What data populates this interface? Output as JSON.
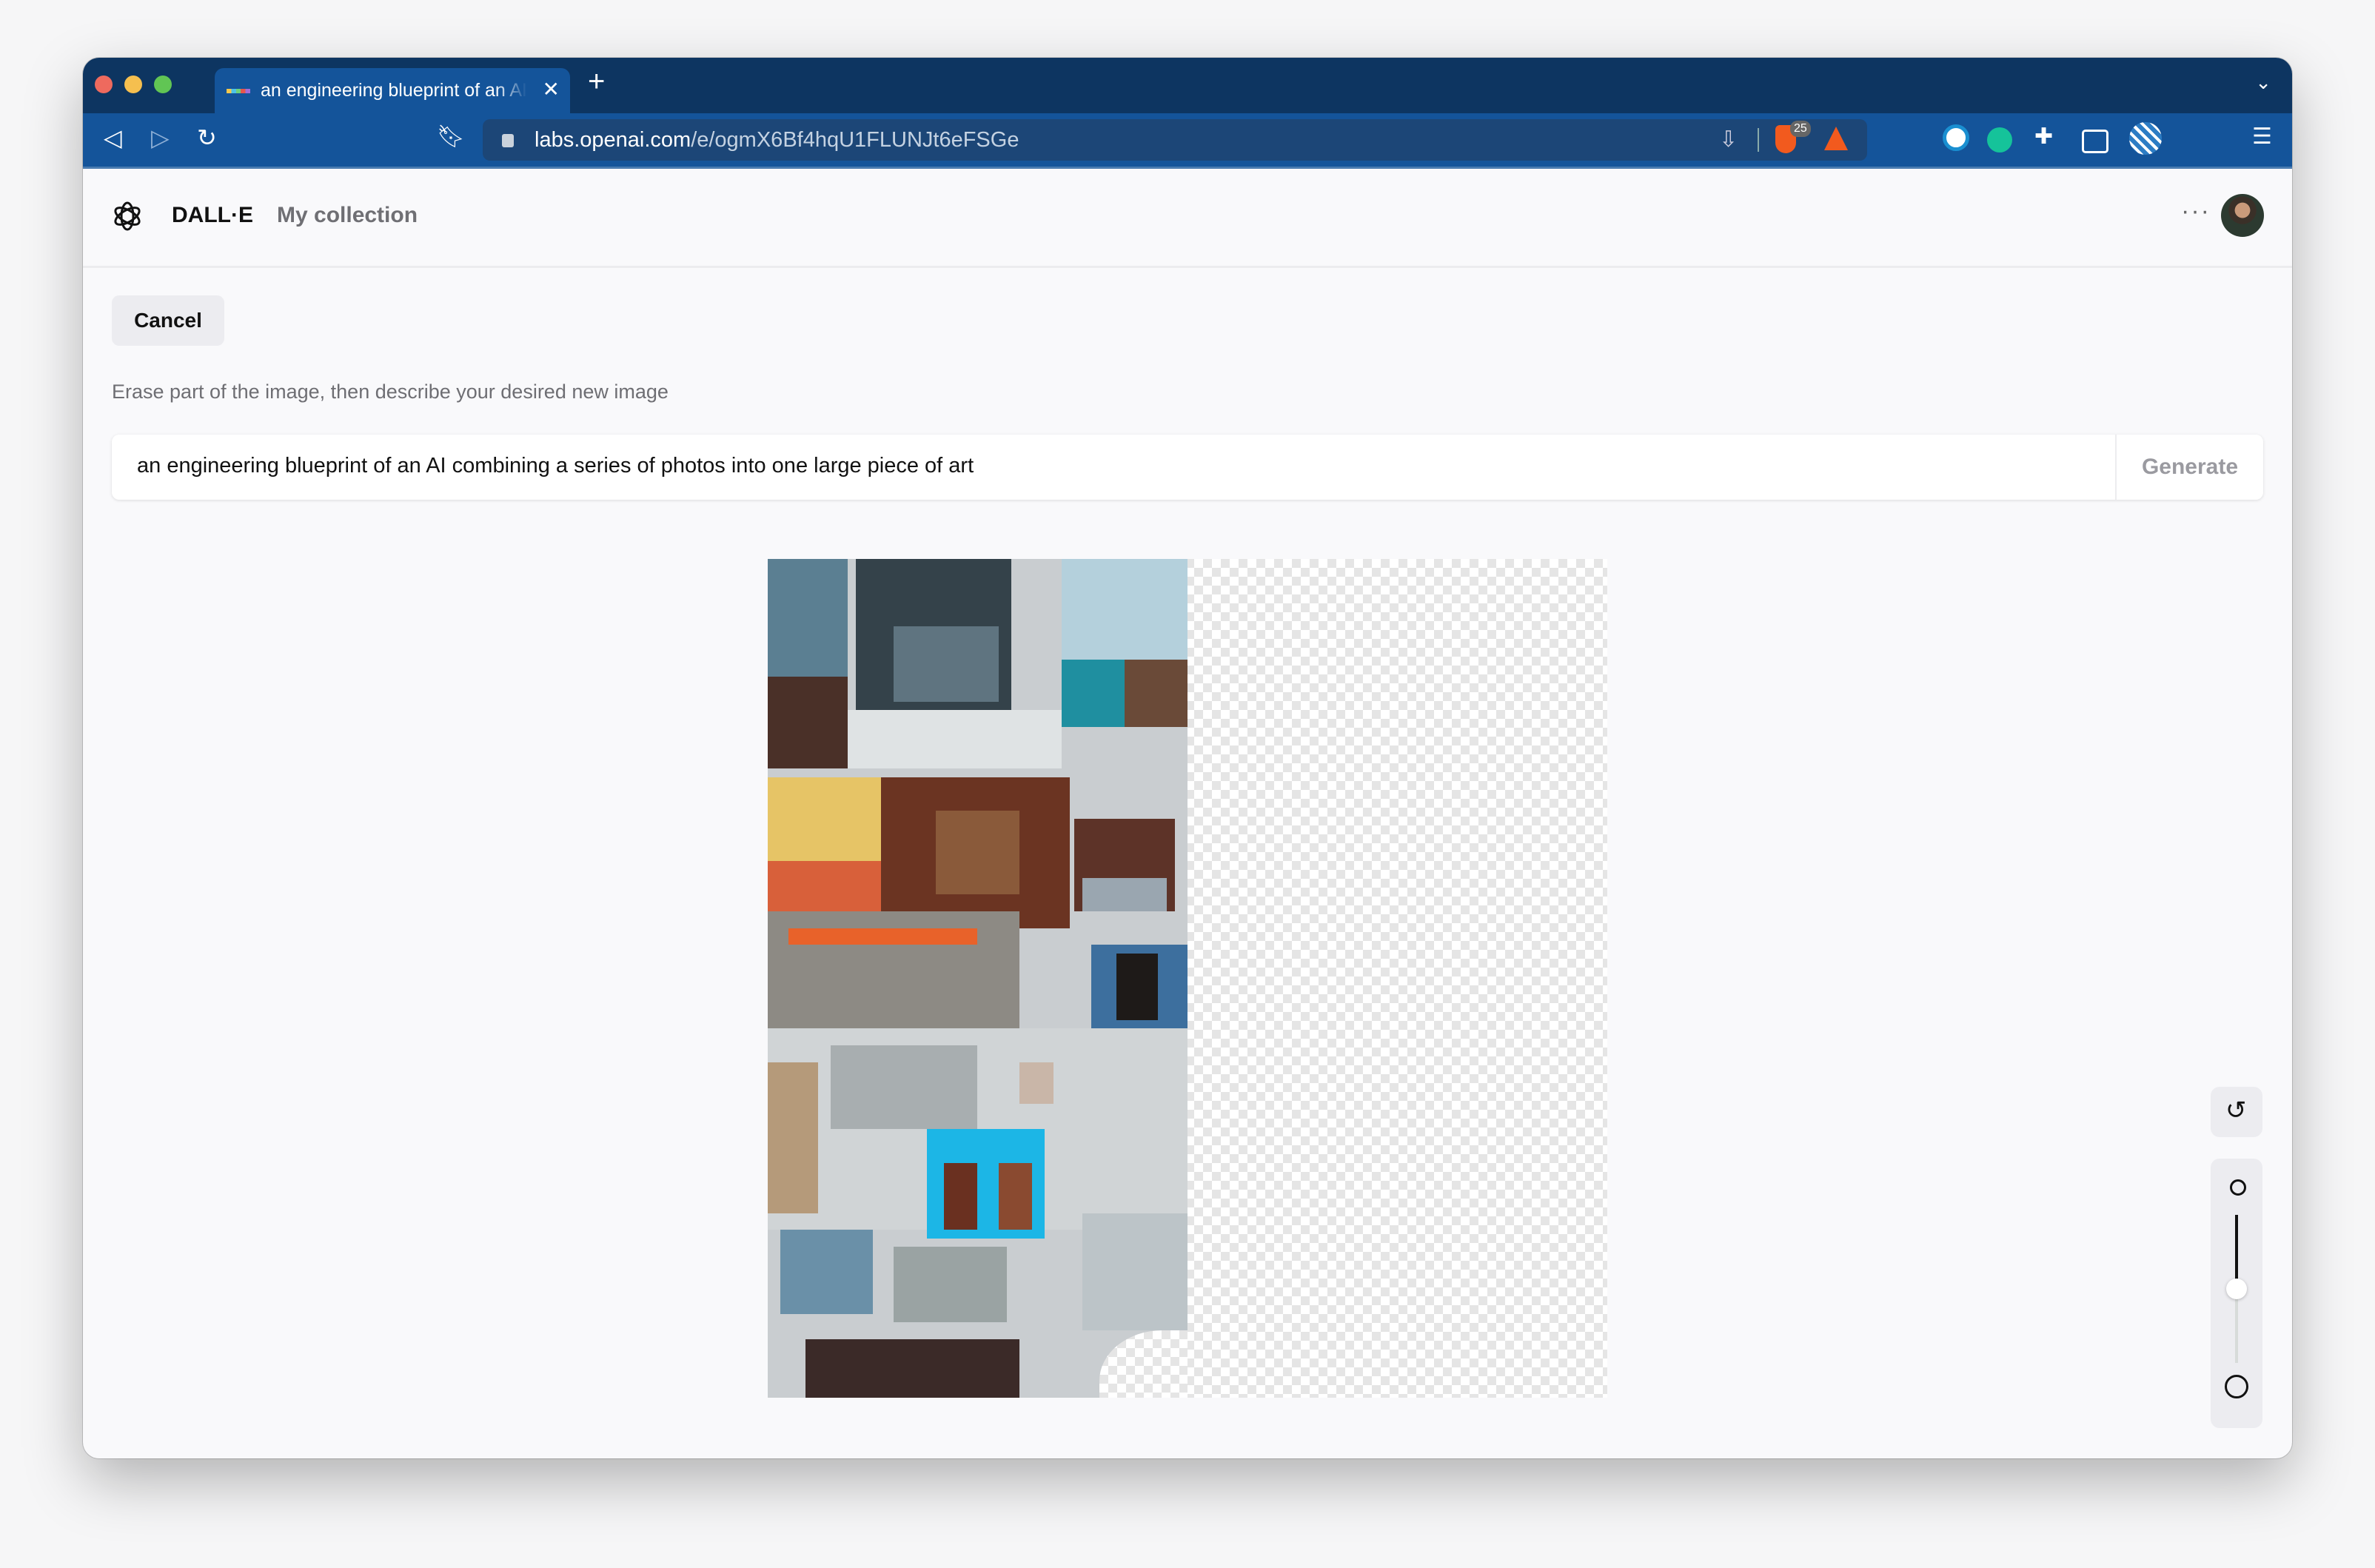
{
  "browser": {
    "tab_title": "an engineering blueprint of an AI combining a series of photos into one large piece of art",
    "url_host": "labs.openai.com",
    "url_path": "/e/ogmX6Bf4hqU1FLUNJt6eFSGe",
    "brave_shield_count": "25",
    "icons": [
      "back-icon",
      "forward-icon",
      "reload-icon",
      "bookmark-icon",
      "lock-icon",
      "install-icon",
      "brave-shield-icon",
      "brave-rewards-icon",
      "1password-icon",
      "grammarly-icon",
      "extensions-icon",
      "wallet-icon",
      "profile-extension-icon",
      "menu-icon"
    ]
  },
  "header": {
    "brand": "DALL·E",
    "nav_my_collection": "My collection",
    "more": "···"
  },
  "editor": {
    "cancel_label": "Cancel",
    "hint": "Erase part of the image, then describe your desired new image",
    "prompt_value": "an engineering blueprint of an AI combining a series of photos into one large piece of art",
    "generate_label": "Generate",
    "brush_size_fraction": 0.5
  },
  "colors": {
    "tabbar": "#0d3561",
    "toolbar": "#14549a",
    "page_bg": "#f9f9fb"
  }
}
